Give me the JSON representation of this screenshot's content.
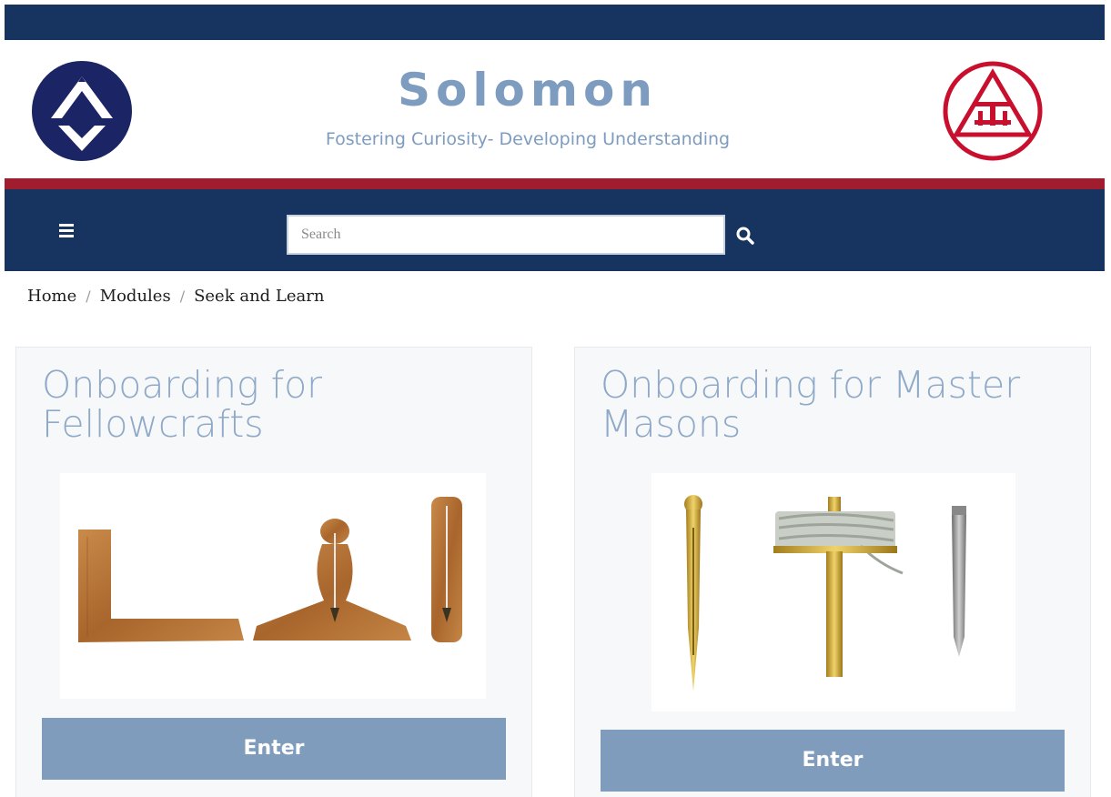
{
  "site": {
    "title": "Solomon",
    "tagline": "Fostering Curiosity- Developing Understanding",
    "logo_left_icon": "square-compasses-emblem-icon",
    "logo_right_icon": "triple-tau-emblem-icon"
  },
  "nav": {
    "menu_icon": "hamburger-menu-icon",
    "search_placeholder": "Search",
    "search_value": "",
    "search_icon": "magnifier-search-icon"
  },
  "breadcrumb": {
    "items": [
      "Home",
      "Modules",
      "Seek and Learn"
    ],
    "separator": "/"
  },
  "cards": [
    {
      "title": "Onboarding for Fellowcrafts",
      "image": "wooden-square-level-plumb-tools",
      "button_label": "Enter"
    },
    {
      "title": "Onboarding for Master Masons",
      "image": "brass-skirret-pencil-compasses-tools",
      "button_label": "Enter"
    }
  ],
  "colors": {
    "navy": "#17335f",
    "red_stripe": "#a01c2f",
    "accent_blue": "#7d9cc0",
    "button_blue": "#7f9cbd",
    "emblem_red": "#c8102e"
  }
}
